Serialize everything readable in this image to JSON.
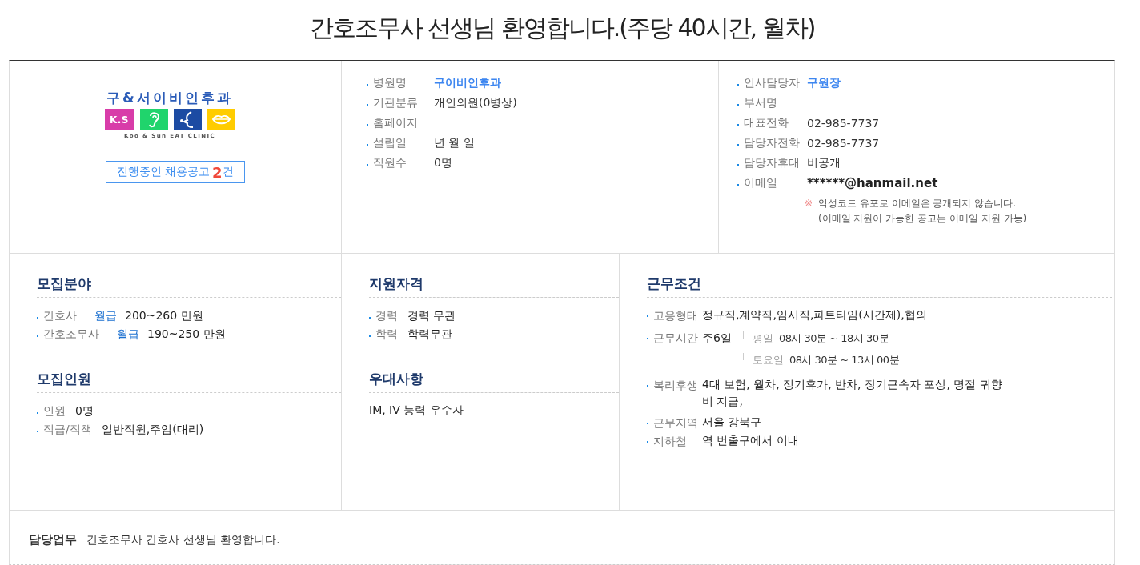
{
  "title": "간호조무사 선생님 환영합니다.(주당 40시간, 월차)",
  "company": {
    "logo": {
      "title": "구&서이비인후과",
      "tiles": [
        {
          "kind": "text",
          "label": "K.S",
          "color": "#d83ca9"
        },
        {
          "kind": "ear",
          "color": "#20d46c"
        },
        {
          "kind": "profile",
          "color": "#1c4ba3"
        },
        {
          "kind": "lips",
          "color": "#ffcc00"
        }
      ],
      "subtitle": "Koo & Sun EAT CLINIC"
    },
    "jobs_button": {
      "prefix": "진행중인 채용공고",
      "count": "2",
      "suffix": "건"
    }
  },
  "hospital_info": [
    {
      "label": "병원명",
      "value": "구이비인후과",
      "kind": "accent"
    },
    {
      "label": "기관분류",
      "value": "개인의원(0병상)",
      "kind": "plain"
    },
    {
      "label": "홈페이지"
    },
    {
      "label": "설립일",
      "value": "년 월 일",
      "kind": "plain"
    },
    {
      "label": "직원수",
      "value": "0명",
      "kind": "plain"
    }
  ],
  "contact_info": {
    "rows": [
      {
        "label": "인사담당자",
        "value": "구원장",
        "kind": "accent"
      },
      {
        "label": "부서명"
      },
      {
        "label": "대표전화",
        "value": "02-985-7737",
        "kind": "plain"
      },
      {
        "label": "담당자전화",
        "value": "02-985-7737",
        "kind": "plain"
      },
      {
        "label": "담당자휴대",
        "value": "비공개",
        "kind": "plain"
      },
      {
        "label": "이메일",
        "value": "******@hanmail.net",
        "kind": "strong"
      }
    ],
    "notice": {
      "mark": "※",
      "lines": [
        "악성코드 유포로 이메일은 공개되지 않습니다.",
        "(이메일 지원이 가능한 공고는 이메일 지원 가능)"
      ]
    }
  },
  "columns": [
    {
      "sections": [
        {
          "heading": "모집분야",
          "kind": "list",
          "items": [
            {
              "label": "간호사",
              "pay_type": "월급",
              "value": "200~260 만원"
            },
            {
              "label": "간호조무사",
              "pay_type": "월급",
              "value": "190~250 만원"
            }
          ]
        },
        {
          "heading": "모집인원",
          "kind": "list",
          "items": [
            {
              "label": "인원",
              "value": "0명"
            },
            {
              "label": "직급/직책",
              "value": "일반직원,주임(대리)"
            }
          ]
        }
      ]
    },
    {
      "sections": [
        {
          "heading": "지원자격",
          "kind": "list",
          "items": [
            {
              "label": "경력",
              "value": "경력 무관"
            },
            {
              "label": "학력",
              "value": "학력무관"
            }
          ]
        },
        {
          "heading": "우대사항",
          "kind": "text",
          "text": "IM, IV 능력 우수자"
        }
      ]
    },
    {
      "sections": [
        {
          "heading": "근무조건",
          "kind": "table",
          "items": [
            {
              "label": "고용형태",
              "value": "정규직,계약직,임시직,파트타임(시간제),협의"
            },
            {
              "label": "근무시간",
              "value": "주6일",
              "schedule": [
                {
                  "label": "평일",
                  "value": "08시 30분 ~ 18시 30분"
                },
                {
                  "label": "토요일",
                  "value": "08시 30분 ~ 13시 00분"
                }
              ]
            },
            {
              "label": "복리후생",
              "value": "4대 보험, 월차, 정기휴가, 반차, 장기근속자 포상, 명절 귀향비 지급,"
            },
            {
              "label": "근무지역",
              "value": "서울 강북구"
            },
            {
              "label": "지하철",
              "value": "역 번출구에서 이내"
            }
          ]
        }
      ]
    }
  ],
  "duty": {
    "label": "담당업무",
    "text": "간호조무사 간호사 선생님 환영합니다."
  }
}
